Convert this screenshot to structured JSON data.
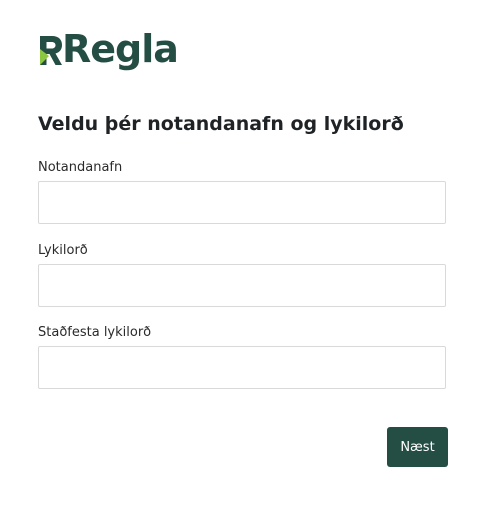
{
  "brand": {
    "name": "Regla",
    "color": "#244e44",
    "accent_color": "#8dc63f"
  },
  "form": {
    "title": "Veldu þér notandanafn og lykilorð",
    "fields": [
      {
        "label": "Notandanafn",
        "value": "",
        "placeholder": ""
      },
      {
        "label": "Lykilorð",
        "value": "",
        "placeholder": ""
      },
      {
        "label": "Staðfesta lykilorð",
        "value": "",
        "placeholder": ""
      }
    ],
    "submit_label": "Næst"
  }
}
